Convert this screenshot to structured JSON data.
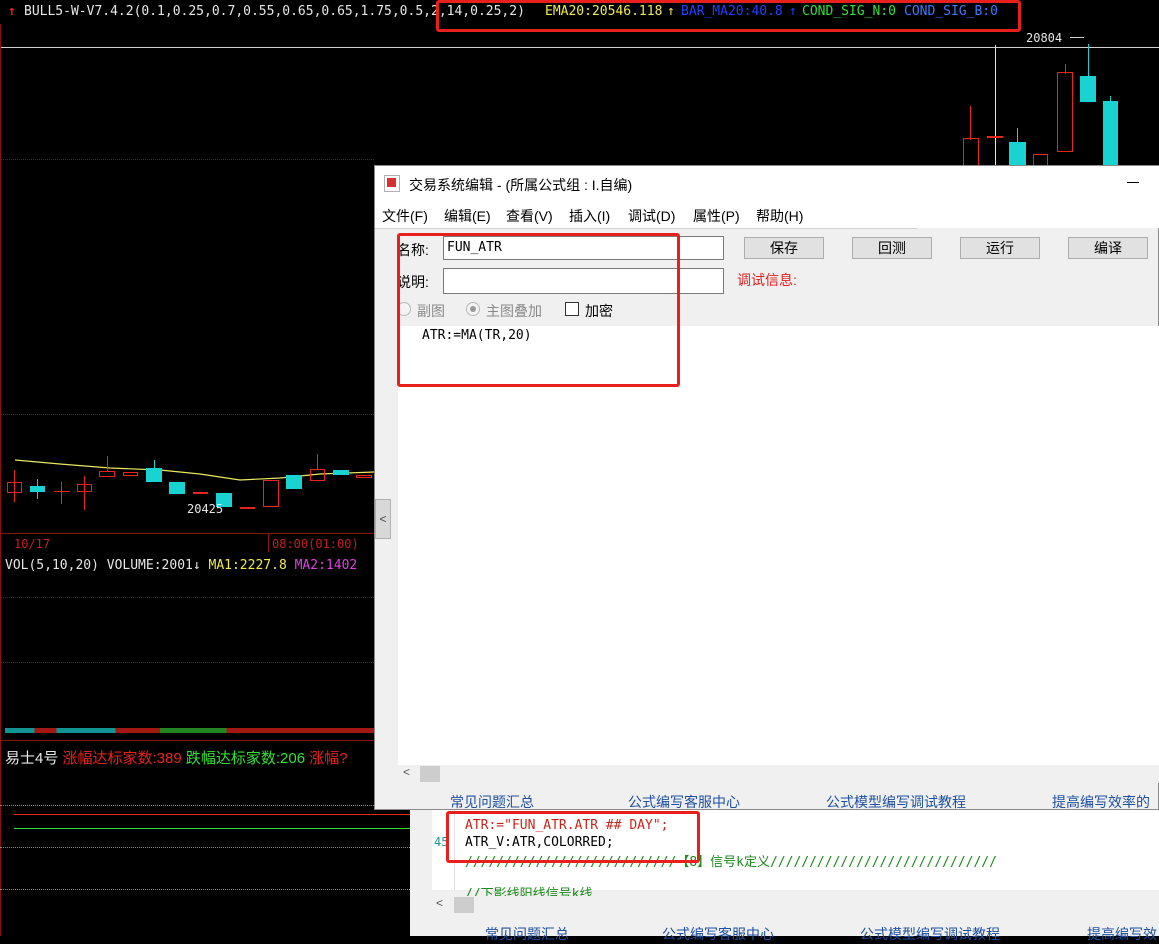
{
  "header": {
    "formula": "BULL5-W-V7.4.2(0.1,0.25,0.7,0.55,0.65,0.65,1.75,0.5,2,14,0.25,2)",
    "ema20": "EMA20:20546.118",
    "ema20_arrow": "↑",
    "bar_ma20": "BAR_MA20:40.8",
    "bar_ma20_arrow": "↑",
    "cond_sig_n": "COND_SIG_N:0",
    "cond_sig_b": "COND_SIG_B:0"
  },
  "chart": {
    "high_label": "20804",
    "low_label": "20425",
    "date_label": "10/17",
    "time_label": "08:00(01:00)",
    "volume_legend": {
      "vol": "VOL(5,10,20)",
      "volume": "VOLUME:2001",
      "arrow": "↓",
      "ma1": "MA1:2227.8",
      "ma2": "MA2:1402"
    },
    "breadth_legend": {
      "name": "易士4号",
      "up": "涨幅达标家数:389",
      "down": "跌幅达标家数:206",
      "up2": "涨幅?"
    }
  },
  "dialog": {
    "title": "交易系统编辑 - (所属公式组 : I.自编)",
    "menu": [
      "文件(F)",
      "编辑(E)",
      "查看(V)",
      "插入(I)",
      "调试(D)",
      "属性(P)",
      "帮助(H)"
    ],
    "name_label": "名称:",
    "name_value": "FUN_ATR",
    "desc_label": "说明:",
    "desc_value": "",
    "debug_label": "调试信息:",
    "radio_sub": "副图",
    "radio_main": "主图叠加",
    "checkbox_encrypt": "加密",
    "buttons": {
      "save": "保存",
      "backtest": "回测",
      "run": "运行",
      "compile": "编译"
    },
    "code_line": "ATR:=MA(TR,20)",
    "links": [
      "常见问题汇总",
      "公式编写客服中心",
      "公式模型编写调试教程",
      "提高编写效率的"
    ]
  },
  "background_editor": {
    "line_no": "45",
    "line1": "ATR:=\"FUN_ATR.ATR ## DAY\";",
    "line2": "ATR_V:ATR,COLORRED;",
    "line3": "///////////////////////////【8】信号k定义/////////////////////////////",
    "line4": "//下影线阳线信号k线",
    "links": [
      "常见问题汇总",
      "公式编写客服中心",
      "公式模型编写调试教程",
      "提高编写效"
    ]
  },
  "colors": {
    "up_candle": "#e8241c",
    "down_candle": "#19d3d3",
    "ema_line": "#e8e860",
    "highlight_box": "#e8201c"
  }
}
